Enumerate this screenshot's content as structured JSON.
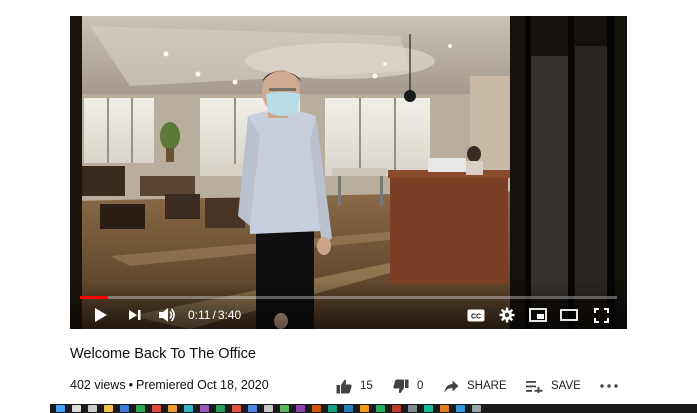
{
  "player": {
    "progress": 0.052,
    "current_time": "0:11",
    "separator": "/",
    "duration": "3:40",
    "controls": {
      "play_icon": "play-icon",
      "next_icon": "next-icon",
      "volume_icon": "volume-icon",
      "cc_label": "CC",
      "settings_icon": "gear-icon",
      "miniplayer_icon": "miniplayer-icon",
      "theater_icon": "theater-mode-icon",
      "fullscreen_icon": "fullscreen-icon"
    },
    "accent_color": "#ff0000"
  },
  "video": {
    "title": "Welcome Back To The Office",
    "views": "402 views",
    "premiered": "Premiered Oct 18, 2020"
  },
  "actions": {
    "likes": "15",
    "dislikes": "0",
    "share_label": "SHARE",
    "save_label": "SAVE",
    "more_icon": "more-horizontal-icon"
  },
  "taskbar": {
    "icons": [
      "windows-icon",
      "search-icon",
      "task-view-icon",
      "file-explorer-icon",
      "app-icon",
      "app-icon",
      "app-icon",
      "app-icon",
      "app-icon",
      "app-icon",
      "app-icon",
      "app-icon",
      "app-icon",
      "app-icon",
      "app-icon",
      "app-icon",
      "app-icon",
      "app-icon",
      "app-icon",
      "app-icon",
      "app-icon",
      "app-icon",
      "app-icon",
      "app-icon",
      "app-icon",
      "app-icon",
      "app-icon"
    ]
  }
}
